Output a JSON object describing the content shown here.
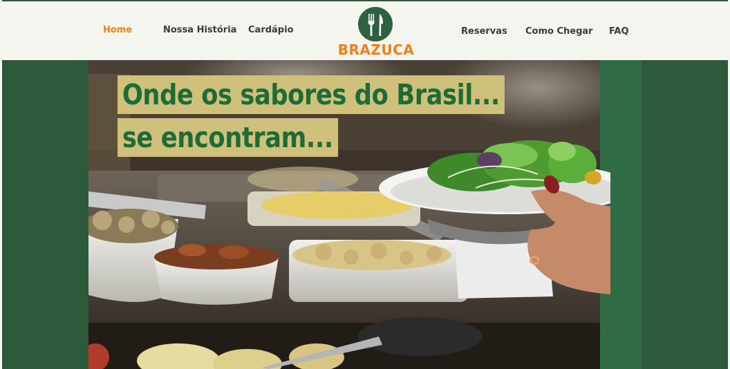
{
  "header": {
    "nav_left": [
      {
        "label": "Home",
        "active": true
      },
      {
        "label": "Nossa História",
        "active": false
      },
      {
        "label": "Cardápio",
        "active": false
      }
    ],
    "nav_right": [
      {
        "label": "Reservas",
        "active": false
      },
      {
        "label": "Como Chegar",
        "active": false
      },
      {
        "label": "FAQ",
        "active": false
      }
    ],
    "logo": {
      "text": "BRAZUCA",
      "icon": "fork-knife-icon"
    }
  },
  "hero": {
    "headline_line1": "Onde os sabores do Brasil...",
    "headline_line2": "se encontram..."
  },
  "colors": {
    "brand_green": "#2c5a3b",
    "accent_orange": "#f07e1b",
    "headline_green": "#1f6b35",
    "headline_bg": "#cfc07b",
    "header_bg": "#f5f5f0"
  }
}
